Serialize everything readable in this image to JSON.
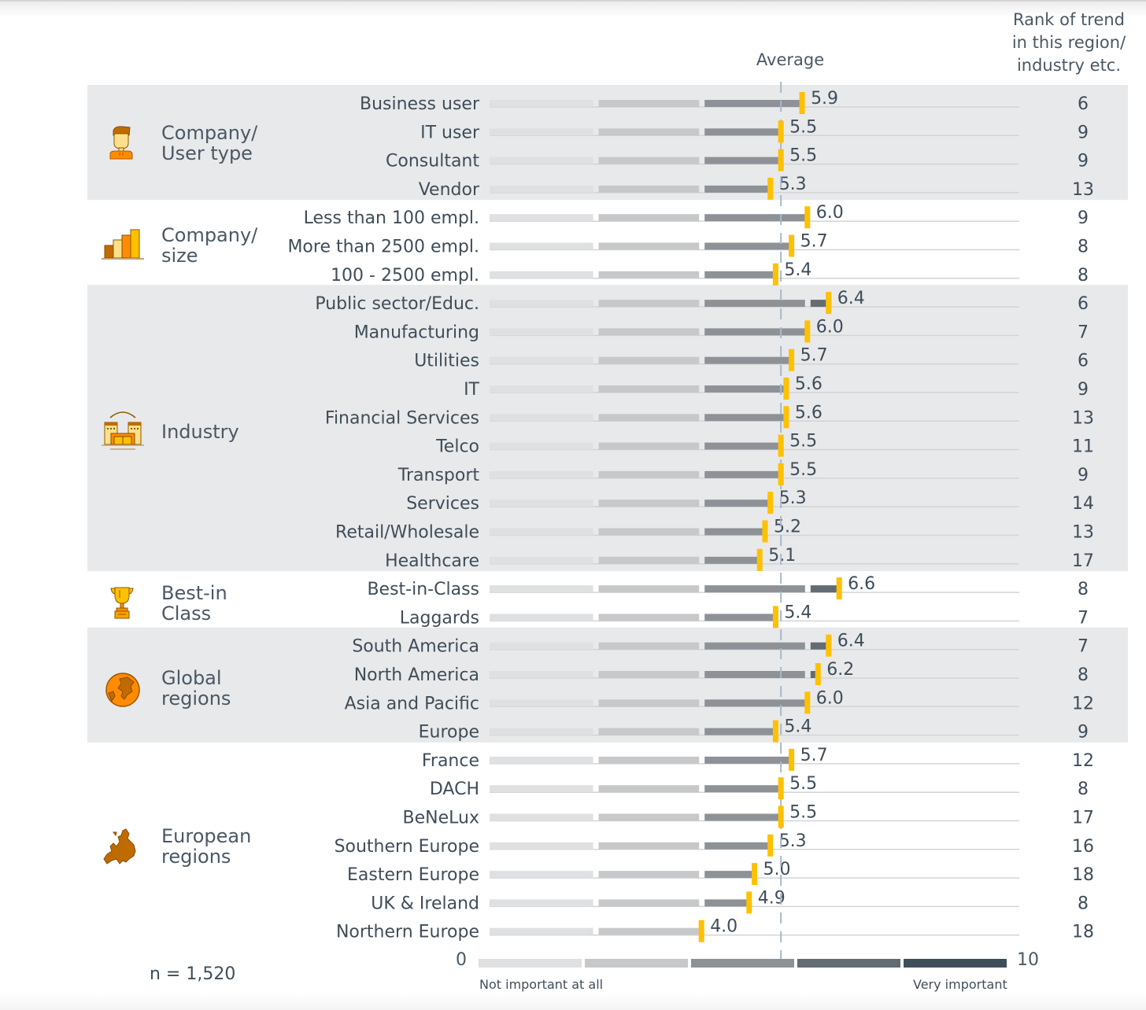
{
  "header": {
    "average_label": "Average",
    "rank_header": [
      "Rank of trend",
      "in this region/",
      "industry etc."
    ]
  },
  "groups": [
    {
      "label": [
        "Company/",
        "User type"
      ],
      "icon": "user-icon",
      "shaded": true
    },
    {
      "label": [
        "Company/",
        "size"
      ],
      "icon": "bar-chart-icon",
      "shaded": false
    },
    {
      "label": [
        "Industry"
      ],
      "icon": "factory-building-icon",
      "shaded": true
    },
    {
      "label": [
        "Best-in",
        "Class"
      ],
      "icon": "trophy-icon",
      "shaded": false
    },
    {
      "label": [
        "Global",
        "regions"
      ],
      "icon": "globe-icon",
      "shaded": true
    },
    {
      "label": [
        "European",
        "regions"
      ],
      "icon": "europe-map-icon",
      "shaded": false
    }
  ],
  "footer": {
    "sample_size": "n = 1,520",
    "scale_min_label": "Not important at all",
    "scale_max_label": "Very important"
  },
  "colors": {
    "marker": "#ffc000",
    "band": "#e8e9ea",
    "seg1": "#dfe0e2",
    "seg2": "#c7c8ca",
    "seg3": "#8e9296",
    "seg4": "#636b73",
    "seg5": "#3f4e5b",
    "avg_line": "#aab8c8",
    "text": "#3f4d5a"
  },
  "chart_data": {
    "type": "bar",
    "title": "",
    "xlabel": "",
    "ylabel": "",
    "xlim": [
      0,
      10
    ],
    "x_tick_labels": [
      "0",
      "10"
    ],
    "scale_labels": {
      "min": "Not important at all",
      "max": "Very important"
    },
    "average": 5.5,
    "average_label": "Average",
    "rank_column_header": "Rank of trend in this region/ industry etc.",
    "sample_size": "n = 1,520",
    "groups": [
      {
        "name": "Company/ User type",
        "rows": [
          {
            "label": "Business user",
            "value": 5.9,
            "rank": 6
          },
          {
            "label": "IT user",
            "value": 5.5,
            "rank": 9
          },
          {
            "label": "Consultant",
            "value": 5.5,
            "rank": 9
          },
          {
            "label": "Vendor",
            "value": 5.3,
            "rank": 13
          }
        ]
      },
      {
        "name": "Company/ size",
        "rows": [
          {
            "label": "Less than 100 empl.",
            "value": 6.0,
            "rank": 9
          },
          {
            "label": "More than 2500 empl.",
            "value": 5.7,
            "rank": 8
          },
          {
            "label": "100 - 2500 empl.",
            "value": 5.4,
            "rank": 8
          }
        ]
      },
      {
        "name": "Industry",
        "rows": [
          {
            "label": "Public sector/Educ.",
            "value": 6.4,
            "rank": 6
          },
          {
            "label": "Manufacturing",
            "value": 6.0,
            "rank": 7
          },
          {
            "label": "Utilities",
            "value": 5.7,
            "rank": 6
          },
          {
            "label": "IT",
            "value": 5.6,
            "rank": 9
          },
          {
            "label": "Financial Services",
            "value": 5.6,
            "rank": 13
          },
          {
            "label": "Telco",
            "value": 5.5,
            "rank": 11
          },
          {
            "label": "Transport",
            "value": 5.5,
            "rank": 9
          },
          {
            "label": "Services",
            "value": 5.3,
            "rank": 14
          },
          {
            "label": "Retail/Wholesale",
            "value": 5.2,
            "rank": 13
          },
          {
            "label": "Healthcare",
            "value": 5.1,
            "rank": 17
          }
        ]
      },
      {
        "name": "Best-in Class",
        "rows": [
          {
            "label": "Best-in-Class",
            "value": 6.6,
            "rank": 8
          },
          {
            "label": "Laggards",
            "value": 5.4,
            "rank": 7
          }
        ]
      },
      {
        "name": "Global regions",
        "rows": [
          {
            "label": "South America",
            "value": 6.4,
            "rank": 7
          },
          {
            "label": "North America",
            "value": 6.2,
            "rank": 8
          },
          {
            "label": "Asia and Pacific",
            "value": 6.0,
            "rank": 12
          },
          {
            "label": "Europe",
            "value": 5.4,
            "rank": 9
          }
        ]
      },
      {
        "name": "European regions",
        "rows": [
          {
            "label": "France",
            "value": 5.7,
            "rank": 12
          },
          {
            "label": "DACH",
            "value": 5.5,
            "rank": 8
          },
          {
            "label": "BeNeLux",
            "value": 5.5,
            "rank": 17
          },
          {
            "label": "Southern Europe",
            "value": 5.3,
            "rank": 16
          },
          {
            "label": "Eastern Europe",
            "value": 5.0,
            "rank": 18
          },
          {
            "label": "UK & Ireland",
            "value": 4.9,
            "rank": 8
          },
          {
            "label": "Northern Europe",
            "value": 4.0,
            "rank": 18
          }
        ]
      }
    ]
  }
}
